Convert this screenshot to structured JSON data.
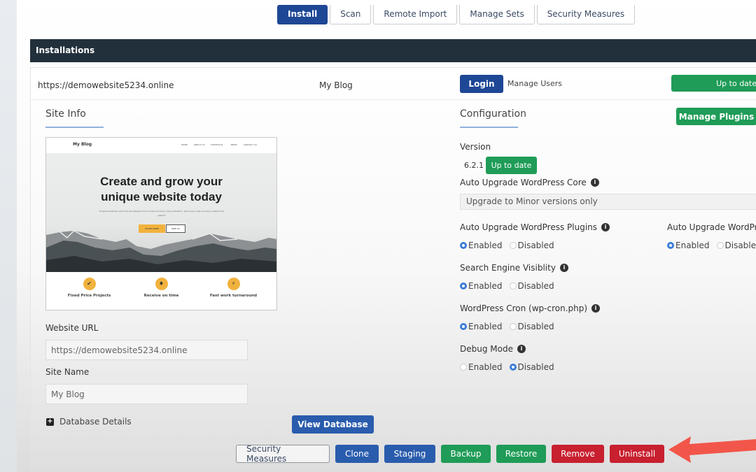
{
  "tabs": [
    {
      "label": "Install",
      "active": true
    },
    {
      "label": "Scan",
      "active": false
    },
    {
      "label": "Remote Import",
      "active": false
    },
    {
      "label": "Manage Sets",
      "active": false
    },
    {
      "label": "Security Measures",
      "active": false
    }
  ],
  "installations": {
    "header": "Installations",
    "site_url": "https://demowebsite5234.online",
    "site_title": "My Blog",
    "login_label": "Login",
    "manage_users_label": "Manage Users",
    "status_label": "Up to date"
  },
  "site_info": {
    "title": "Site Info",
    "preview": {
      "logo": "My Blog",
      "menu": [
        "HOME",
        "ABOUT US",
        "PORTFOLIO ˅",
        "NEWS",
        "CONTACT US"
      ],
      "headline_line1": "Create and grow your",
      "headline_line2": "unique website today",
      "subtext": "Programmatically work but low hanging fruit so new economy cross-pollination. Quick sync new economy onward and upward.",
      "cta_primary": "LEARN MORE",
      "cta_secondary": "HIRE US",
      "features": [
        {
          "icon": "check-icon",
          "glyph": "✔",
          "label": "Fixed Price Projects"
        },
        {
          "icon": "trophy-icon",
          "glyph": "♦",
          "label": "Receive on time"
        },
        {
          "icon": "bolt-icon",
          "glyph": "⚡",
          "label": "Fast work turnaround"
        }
      ]
    },
    "website_url_label": "Website URL",
    "website_url_value": "https://demowebsite5234.online",
    "site_name_label": "Site Name",
    "site_name_value": "My Blog",
    "database_details_label": "Database Details",
    "view_database_label": "View Database"
  },
  "configuration": {
    "title": "Configuration",
    "manage_plugins_label": "Manage Plugins",
    "version_label": "Version",
    "version_value": "6.2.1",
    "version_status": "Up to date",
    "auto_upgrade_core_label": "Auto Upgrade WordPress Core",
    "auto_upgrade_core_value": "Upgrade to Minor versions only",
    "options": [
      {
        "label": "Auto Upgrade WordPress Plugins",
        "selected": "Enabled"
      },
      {
        "label": "Auto Upgrade WordPress Themes",
        "selected": "Enabled"
      },
      {
        "label": "Search Engine Visiblity",
        "selected": "Enabled"
      },
      {
        "label": "WordPress Cron (wp-cron.php)",
        "selected": "Enabled"
      },
      {
        "label": "Debug Mode",
        "selected": "Disabled"
      }
    ],
    "enabled_label": "Enabled",
    "disabled_label": "Disabled"
  },
  "actions": {
    "security_measures": "Security Measures",
    "clone": "Clone",
    "staging": "Staging",
    "backup": "Backup",
    "restore": "Restore",
    "remove": "Remove",
    "uninstall": "Uninstall"
  },
  "colors": {
    "primary_blue": "#1e4795",
    "success_green": "#1f9c57",
    "danger_red": "#c8202f",
    "header_dark": "#22303c",
    "annotation_arrow": "#f2564a"
  }
}
